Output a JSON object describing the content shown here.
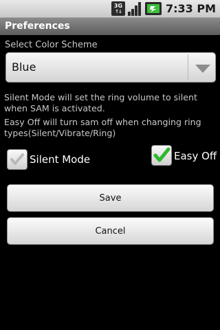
{
  "status_bar": {
    "network_label": "3G",
    "time": "7:33 PM",
    "icons": [
      "3g-icon",
      "signal-icon",
      "battery-charging-icon"
    ]
  },
  "title_bar": {
    "title": "Preferences"
  },
  "color_scheme": {
    "label": "Select Color Scheme",
    "selected": "Blue"
  },
  "descriptions": {
    "silent_mode": "Silent Mode will set the ring volume to silent when SAM is activated.",
    "easy_off": "Easy Off will turn sam off when changing ring types(Silent/Vibrate/Ring)"
  },
  "options": {
    "silent_mode": {
      "label": "Silent Mode",
      "checked": false
    },
    "easy_off": {
      "label": "Easy Off",
      "checked": true
    }
  },
  "buttons": {
    "save": "Save",
    "cancel": "Cancel"
  },
  "colors": {
    "background": "#000000",
    "check_green": "#2fb82f",
    "text_dim": "#c8c8c8"
  }
}
